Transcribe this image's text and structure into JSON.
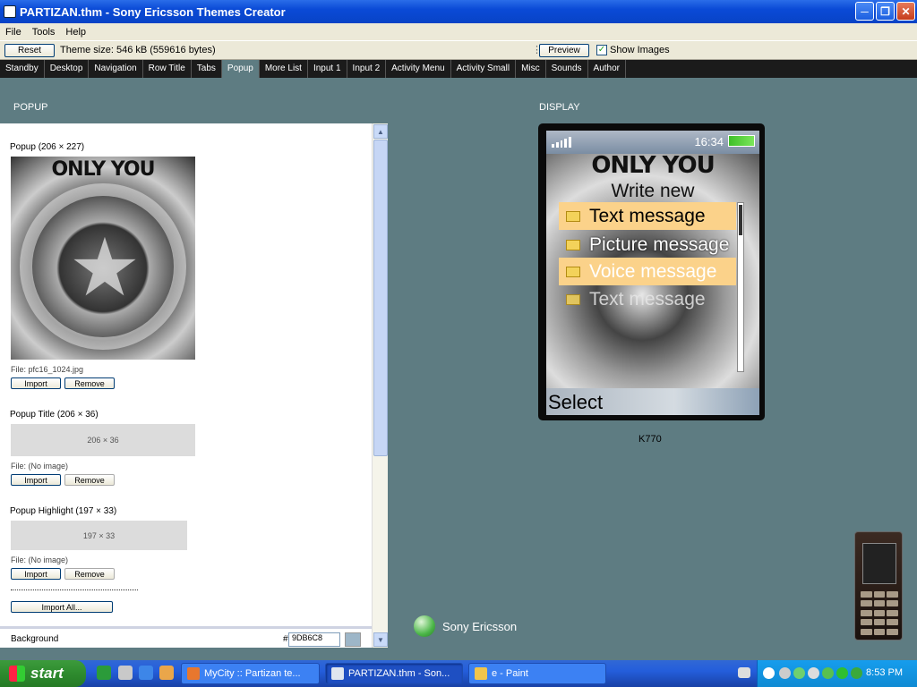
{
  "window": {
    "title": "PARTIZAN.thm - Sony Ericsson Themes Creator"
  },
  "menu": [
    "File",
    "Tools",
    "Help"
  ],
  "toolbar": {
    "reset_label": "Reset",
    "theme_size": "Theme size: 546 kB (559616 bytes)",
    "preview_label": "Preview",
    "show_images_label": "Show Images",
    "show_images_checked": true
  },
  "tabs": [
    "Standby",
    "Desktop",
    "Navigation",
    "Row Title",
    "Tabs",
    "Popup",
    "More List",
    "Input 1",
    "Input 2",
    "Activity Menu",
    "Activity Small",
    "Misc",
    "Sounds",
    "Author"
  ],
  "active_tab": "Popup",
  "left": {
    "section_label": "POPUP",
    "popup": {
      "title": "Popup (206 × 227)",
      "image_caption": "ONLY YOU",
      "file": "File: pfc16_1024.jpg"
    },
    "popup_title": {
      "title": "Popup Title (206 × 36)",
      "placeholder": "206 × 36",
      "file": "File: (No image)"
    },
    "popup_highlight": {
      "title": "Popup Highlight (197 × 33)",
      "placeholder": "197 × 33",
      "file": "File: (No image)"
    },
    "import_label": "Import",
    "remove_label": "Remove",
    "import_all_label": "Import All...",
    "background_label": "Background",
    "background_value": "9DB6C8",
    "hash": "#"
  },
  "right": {
    "section_label": "DISPLAY",
    "phone": {
      "clock": "16:34",
      "caption": "ONLY YOU",
      "heading": "Write new",
      "items": [
        "Text message",
        "Picture message",
        "Voice message",
        "Text message"
      ],
      "softkey": "Select"
    },
    "model": "K770",
    "brand": "Sony Ericsson"
  },
  "taskbar": {
    "start_label": "start",
    "tasks": [
      "MyCity :: Partizan te...",
      "PARTIZAN.thm - Son...",
      "e - Paint"
    ],
    "clock": "8:53 PM"
  }
}
